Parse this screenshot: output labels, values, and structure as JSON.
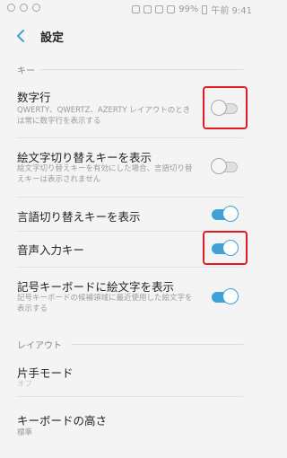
{
  "status_bar": {
    "battery": "99%",
    "time": "午前 9:41"
  },
  "header": {
    "title": "設定"
  },
  "sections": [
    {
      "header": "キー"
    },
    {
      "header": "レイアウト"
    }
  ],
  "items": [
    {
      "title": "数字行",
      "subtitle": "QWERTY、QWERTZ、AZERTY レイアウトのときは常に数字行を表示する",
      "toggle": "off"
    },
    {
      "title": "絵文字切り替えキーを表示",
      "subtitle": "絵文字切り替えキーを有効にした場合、言語切り替えキーは表示されません",
      "toggle": "off"
    },
    {
      "title": "言語切り替えキーを表示",
      "toggle": "on"
    },
    {
      "title": "音声入力キー",
      "toggle": "on"
    },
    {
      "title": "記号キーボードに絵文字を表示",
      "subtitle": "記号キーボードの候補領域に最近使用した絵文字を表示する",
      "toggle": "on"
    },
    {
      "title": "片手モード",
      "subtitle": "オフ"
    },
    {
      "title": "キーボードの高さ",
      "subtitle": "標準"
    }
  ],
  "colors": {
    "accent": "#3fa1d6",
    "highlight": "#e31b23"
  }
}
